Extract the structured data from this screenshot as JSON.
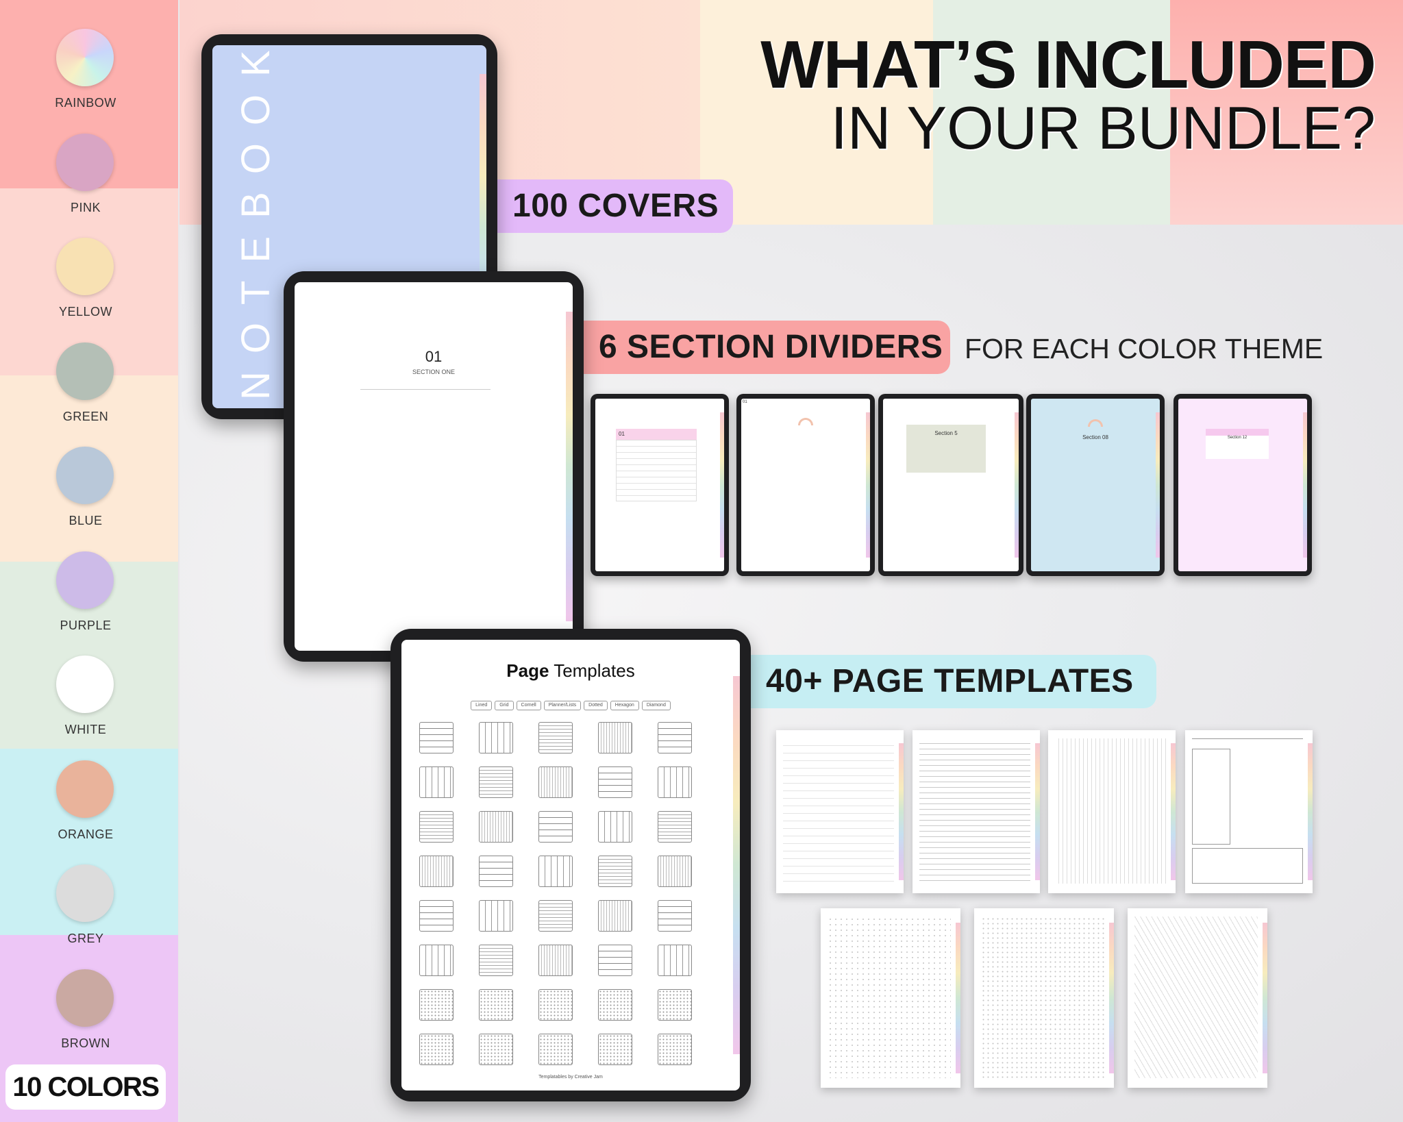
{
  "title": {
    "line1": "WHAT’S INCLUDED",
    "line2": "IN YOUR BUNDLE?"
  },
  "colors": {
    "items": [
      {
        "label": "RAINBOW",
        "swatch": "#d6c6ee"
      },
      {
        "label": "PINK",
        "swatch": "#d9a5c4"
      },
      {
        "label": "YELLOW",
        "swatch": "#f8e1b3"
      },
      {
        "label": "GREEN",
        "swatch": "#b4bfb6"
      },
      {
        "label": "BLUE",
        "swatch": "#b9c8d9"
      },
      {
        "label": "PURPLE",
        "swatch": "#cdbbe8"
      },
      {
        "label": "WHITE",
        "swatch": "#ffffff"
      },
      {
        "label": "ORANGE",
        "swatch": "#e9b39b"
      },
      {
        "label": "GREY",
        "swatch": "#dcdcdc"
      },
      {
        "label": "BROWN",
        "swatch": "#caa9a2"
      }
    ],
    "count_label": "10 COLORS"
  },
  "features": {
    "covers": {
      "label": "100 COVERS",
      "color": "#e3b9f9"
    },
    "dividers": {
      "label": "6 SECTION DIVIDERS",
      "sub": "FOR EACH COLOR THEME",
      "color": "#f9a3a3"
    },
    "templates": {
      "label": "40+ PAGE TEMPLATES",
      "color": "#c6eef3"
    }
  },
  "cover_tablet": {
    "text": "NOTEBOOK",
    "color": "#c5d4f5"
  },
  "divider_tablet": {
    "number": "01",
    "name": "SECTION ONE"
  },
  "divider_samples": [
    {
      "label": "01",
      "color": "#ffffff"
    },
    {
      "label": "01",
      "color": "#ffffff"
    },
    {
      "label": "Section 5",
      "color": "#ffffff"
    },
    {
      "label": "Section 08",
      "color": "#cfe7f2"
    },
    {
      "label": "Section 12",
      "color": "#fbe8fc"
    }
  ],
  "templates_tablet": {
    "title_bold": "Page",
    "title_rest": " Templates",
    "buttons": [
      "Lined",
      "Grid",
      "Cornell",
      "Planner/Lists",
      "Dotted",
      "Hexagon",
      "Diamond"
    ],
    "footer": "Templatables by Creative Jam"
  }
}
